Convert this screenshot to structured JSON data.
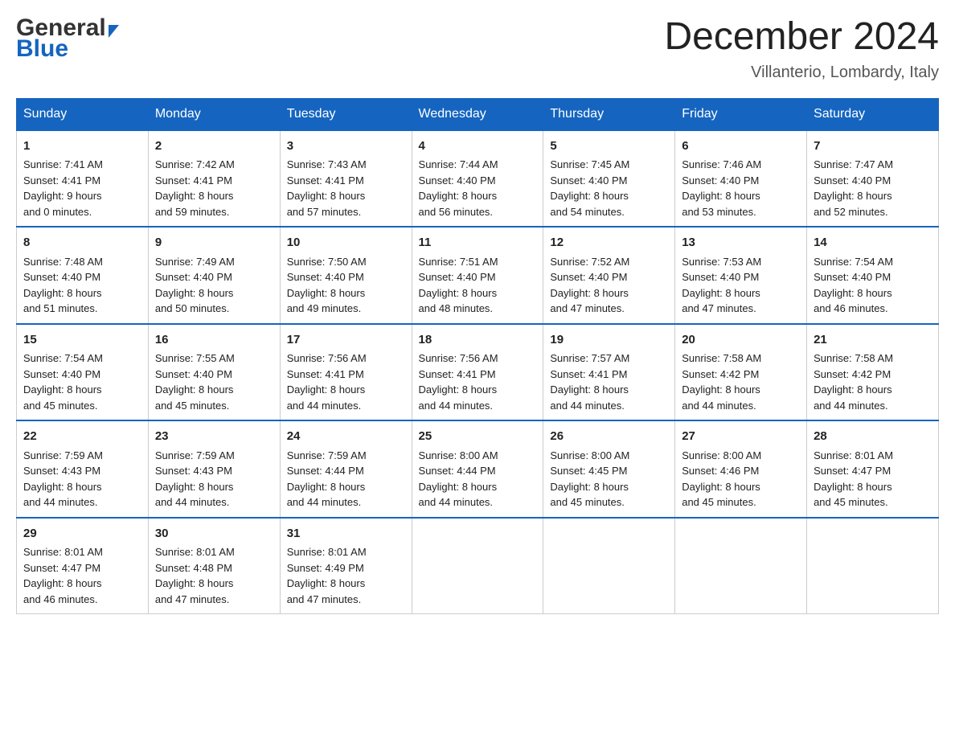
{
  "header": {
    "logo_general": "General",
    "logo_blue": "Blue",
    "month_title": "December 2024",
    "location": "Villanterio, Lombardy, Italy"
  },
  "days_of_week": [
    "Sunday",
    "Monday",
    "Tuesday",
    "Wednesday",
    "Thursday",
    "Friday",
    "Saturday"
  ],
  "weeks": [
    [
      {
        "day": "1",
        "sunrise": "7:41 AM",
        "sunset": "4:41 PM",
        "daylight": "9 hours and 0 minutes."
      },
      {
        "day": "2",
        "sunrise": "7:42 AM",
        "sunset": "4:41 PM",
        "daylight": "8 hours and 59 minutes."
      },
      {
        "day": "3",
        "sunrise": "7:43 AM",
        "sunset": "4:41 PM",
        "daylight": "8 hours and 57 minutes."
      },
      {
        "day": "4",
        "sunrise": "7:44 AM",
        "sunset": "4:40 PM",
        "daylight": "8 hours and 56 minutes."
      },
      {
        "day": "5",
        "sunrise": "7:45 AM",
        "sunset": "4:40 PM",
        "daylight": "8 hours and 54 minutes."
      },
      {
        "day": "6",
        "sunrise": "7:46 AM",
        "sunset": "4:40 PM",
        "daylight": "8 hours and 53 minutes."
      },
      {
        "day": "7",
        "sunrise": "7:47 AM",
        "sunset": "4:40 PM",
        "daylight": "8 hours and 52 minutes."
      }
    ],
    [
      {
        "day": "8",
        "sunrise": "7:48 AM",
        "sunset": "4:40 PM",
        "daylight": "8 hours and 51 minutes."
      },
      {
        "day": "9",
        "sunrise": "7:49 AM",
        "sunset": "4:40 PM",
        "daylight": "8 hours and 50 minutes."
      },
      {
        "day": "10",
        "sunrise": "7:50 AM",
        "sunset": "4:40 PM",
        "daylight": "8 hours and 49 minutes."
      },
      {
        "day": "11",
        "sunrise": "7:51 AM",
        "sunset": "4:40 PM",
        "daylight": "8 hours and 48 minutes."
      },
      {
        "day": "12",
        "sunrise": "7:52 AM",
        "sunset": "4:40 PM",
        "daylight": "8 hours and 47 minutes."
      },
      {
        "day": "13",
        "sunrise": "7:53 AM",
        "sunset": "4:40 PM",
        "daylight": "8 hours and 47 minutes."
      },
      {
        "day": "14",
        "sunrise": "7:54 AM",
        "sunset": "4:40 PM",
        "daylight": "8 hours and 46 minutes."
      }
    ],
    [
      {
        "day": "15",
        "sunrise": "7:54 AM",
        "sunset": "4:40 PM",
        "daylight": "8 hours and 45 minutes."
      },
      {
        "day": "16",
        "sunrise": "7:55 AM",
        "sunset": "4:40 PM",
        "daylight": "8 hours and 45 minutes."
      },
      {
        "day": "17",
        "sunrise": "7:56 AM",
        "sunset": "4:41 PM",
        "daylight": "8 hours and 44 minutes."
      },
      {
        "day": "18",
        "sunrise": "7:56 AM",
        "sunset": "4:41 PM",
        "daylight": "8 hours and 44 minutes."
      },
      {
        "day": "19",
        "sunrise": "7:57 AM",
        "sunset": "4:41 PM",
        "daylight": "8 hours and 44 minutes."
      },
      {
        "day": "20",
        "sunrise": "7:58 AM",
        "sunset": "4:42 PM",
        "daylight": "8 hours and 44 minutes."
      },
      {
        "day": "21",
        "sunrise": "7:58 AM",
        "sunset": "4:42 PM",
        "daylight": "8 hours and 44 minutes."
      }
    ],
    [
      {
        "day": "22",
        "sunrise": "7:59 AM",
        "sunset": "4:43 PM",
        "daylight": "8 hours and 44 minutes."
      },
      {
        "day": "23",
        "sunrise": "7:59 AM",
        "sunset": "4:43 PM",
        "daylight": "8 hours and 44 minutes."
      },
      {
        "day": "24",
        "sunrise": "7:59 AM",
        "sunset": "4:44 PM",
        "daylight": "8 hours and 44 minutes."
      },
      {
        "day": "25",
        "sunrise": "8:00 AM",
        "sunset": "4:44 PM",
        "daylight": "8 hours and 44 minutes."
      },
      {
        "day": "26",
        "sunrise": "8:00 AM",
        "sunset": "4:45 PM",
        "daylight": "8 hours and 45 minutes."
      },
      {
        "day": "27",
        "sunrise": "8:00 AM",
        "sunset": "4:46 PM",
        "daylight": "8 hours and 45 minutes."
      },
      {
        "day": "28",
        "sunrise": "8:01 AM",
        "sunset": "4:47 PM",
        "daylight": "8 hours and 45 minutes."
      }
    ],
    [
      {
        "day": "29",
        "sunrise": "8:01 AM",
        "sunset": "4:47 PM",
        "daylight": "8 hours and 46 minutes."
      },
      {
        "day": "30",
        "sunrise": "8:01 AM",
        "sunset": "4:48 PM",
        "daylight": "8 hours and 47 minutes."
      },
      {
        "day": "31",
        "sunrise": "8:01 AM",
        "sunset": "4:49 PM",
        "daylight": "8 hours and 47 minutes."
      },
      null,
      null,
      null,
      null
    ]
  ],
  "labels": {
    "sunrise": "Sunrise:",
    "sunset": "Sunset:",
    "daylight": "Daylight:"
  }
}
